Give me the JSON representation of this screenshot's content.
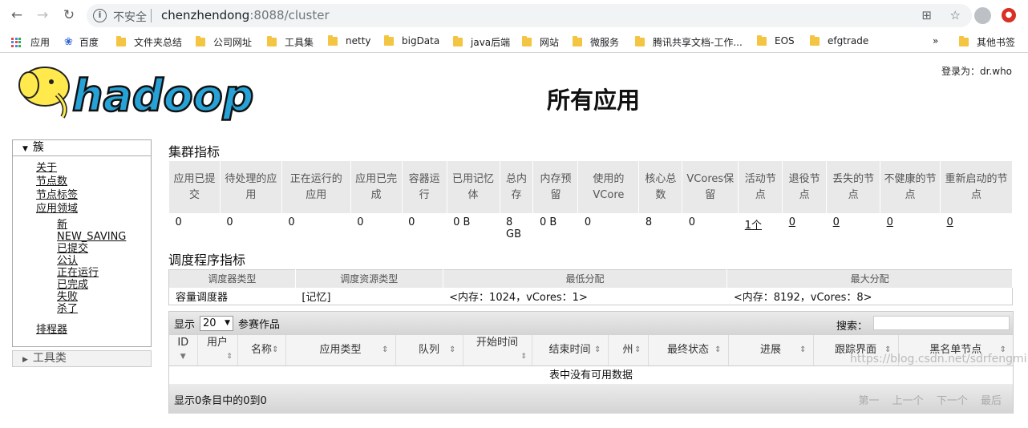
{
  "browser": {
    "insecure_label": "不安全",
    "url_host": "chenzhendong",
    "url_rest": ":8088/cluster",
    "bookmarks": [
      "应用",
      "百度",
      "文件夹总结",
      "公司网址",
      "工具集",
      "netty",
      "bigData",
      "java后端",
      "网站",
      "微服务",
      "腾讯共享文档-工作...",
      "EOS",
      "efgtrade",
      "其他书签"
    ],
    "more": "»"
  },
  "header": {
    "login": "登录为：dr.who",
    "title": "所有应用"
  },
  "nav": {
    "cluster": "簇",
    "items": [
      "关于",
      "节点数",
      "节点标签",
      "应用领域"
    ],
    "sub_items": [
      "新",
      "NEW_SAVING",
      "已提交",
      "公认",
      "正在运行",
      "已完成",
      "失败",
      "杀了"
    ],
    "scheduler": "排程器",
    "tools": "工具类"
  },
  "metrics": {
    "title": "集群指标",
    "headers": [
      "应用已提交",
      "待处理的应用",
      "正在运行的应用",
      "应用已完成",
      "容器运行",
      "已用记忆体",
      "总内存",
      "内存预留",
      "使用的VCore",
      "核心总数",
      "VCores保留",
      "活动节点",
      "退役节点",
      "丢失的节点",
      "不健康的节点",
      "重新启动的节点"
    ],
    "values": [
      "0",
      "0",
      "0",
      "0",
      "0",
      "0 B",
      "8 GB",
      "0 B",
      "0",
      "8",
      "0",
      "1个",
      "0",
      "0",
      "0",
      "0"
    ]
  },
  "scheduler": {
    "title": "调度程序指标",
    "headers": [
      "调度器类型",
      "调度资源类型",
      "最低分配",
      "最大分配"
    ],
    "values": [
      "容量调度器",
      "[记忆]",
      "<内存：1024，vCores：1>",
      "<内存：8192，vCores：8>"
    ]
  },
  "apps": {
    "show_label": "显示",
    "page_size": "20",
    "entries_label": "参赛作品",
    "search_label": "搜索：",
    "headers": [
      "ID",
      "用户",
      "名称",
      "应用类型",
      "队列",
      "开始时间",
      "结束时间",
      "州",
      "最终状态",
      "进展",
      "跟踪界面",
      "黑名单节点"
    ],
    "empty": "表中没有可用数据",
    "footer": "显示0条目中的0到0",
    "pager": [
      "第一",
      "上一个",
      "下一个",
      "最后"
    ]
  },
  "watermark": "https://blog.csdn.net/sdrfengmi"
}
